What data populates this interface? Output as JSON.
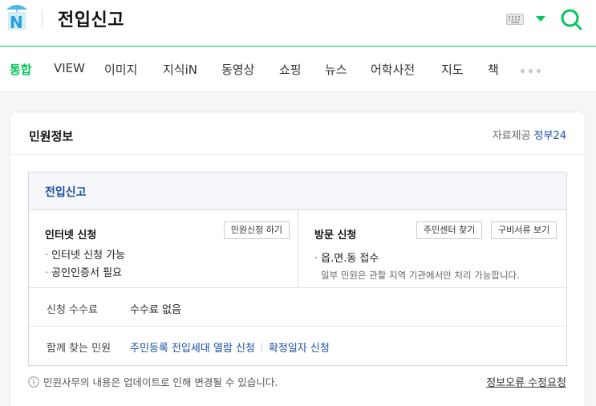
{
  "header": {
    "query": "전입신고",
    "brand_color": "#03c75a"
  },
  "tabs": [
    {
      "label": "통합",
      "active": true
    },
    {
      "label": "VIEW"
    },
    {
      "label": "이미지"
    },
    {
      "label": "지식iN"
    },
    {
      "label": "동영상"
    },
    {
      "label": "쇼핑"
    },
    {
      "label": "뉴스"
    },
    {
      "label": "어학사전"
    },
    {
      "label": "지도"
    },
    {
      "label": "책"
    }
  ],
  "card": {
    "title": "민원정보",
    "source_label": "자료제공",
    "source_link": "정부24",
    "service": {
      "title": "전입신고",
      "internet": {
        "title": "인터넷 신청",
        "button": "민원신청 하기",
        "items": [
          "인터넷 신청 가능",
          "공인인증서 필요"
        ]
      },
      "visit": {
        "title": "방문 신청",
        "buttons": [
          "주민센터 찾기",
          "구비서류 보기"
        ],
        "items": [
          "읍.면.동 접수"
        ],
        "note": "일부 민원은 관할 지역 기관에서만 처리 가능합니다."
      },
      "fee": {
        "label": "신청 수수료",
        "value": "수수료 없음"
      },
      "related": {
        "label": "함께 찾는 민원",
        "links": [
          "주민등록 전입세대 열람 신청",
          "확정일자 신청"
        ]
      }
    },
    "notice": "민원사무의 내용은 업데이트로 인해 변경될 수 있습니다.",
    "report_link": "정보오류 수정요청"
  }
}
